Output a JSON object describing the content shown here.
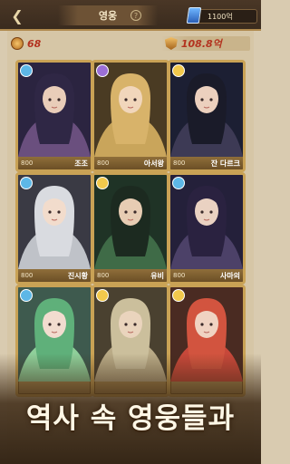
{
  "topbar": {
    "title": "영웅",
    "help_symbol": "?",
    "currency_value": "1100억"
  },
  "stats": {
    "left_value": "68",
    "right_value": "108.8억"
  },
  "heroes": [
    {
      "level": "800",
      "name": "조조",
      "element": "wind",
      "element_color": "#5db7e6"
    },
    {
      "level": "800",
      "name": "아서왕",
      "element": "dark",
      "element_color": "#9b6fd6"
    },
    {
      "level": "800",
      "name": "잔 다르크",
      "element": "light",
      "element_color": "#f2c94c"
    },
    {
      "level": "800",
      "name": "진시황",
      "element": "wind",
      "element_color": "#5db7e6"
    },
    {
      "level": "800",
      "name": "유비",
      "element": "light",
      "element_color": "#f2c94c"
    },
    {
      "level": "800",
      "name": "사마의",
      "element": "wind",
      "element_color": "#5db7e6"
    },
    {
      "level": "",
      "name": "",
      "element": "wind",
      "element_color": "#5db7e6"
    },
    {
      "level": "",
      "name": "",
      "element": "light",
      "element_color": "#f2c94c"
    },
    {
      "level": "",
      "name": "",
      "element": "light",
      "element_color": "#f2c94c"
    }
  ],
  "caption": "역사 속 영웅들과"
}
